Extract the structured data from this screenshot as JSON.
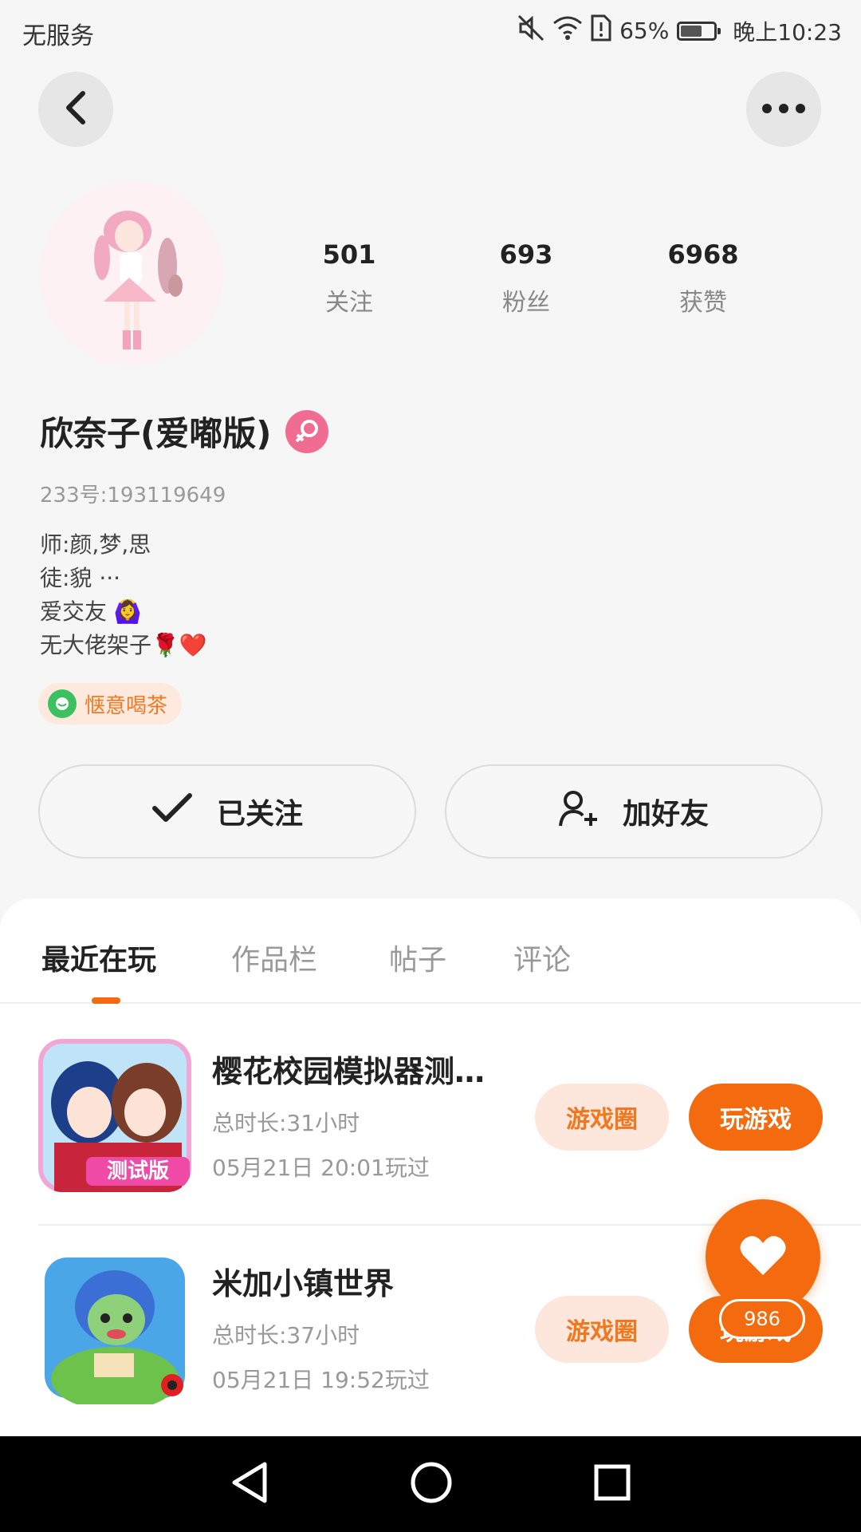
{
  "status_bar": {
    "carrier": "无服务",
    "battery_percent": "65%",
    "battery_level": 0.65,
    "time": "晚上10:23",
    "icons": [
      "mute-icon",
      "wifi-icon",
      "alert-sim-icon",
      "battery-icon"
    ]
  },
  "header": {
    "back_icon": "chevron-left-icon",
    "more_icon": "more-dots-icon"
  },
  "profile": {
    "stats": [
      {
        "value": "501",
        "label": "关注"
      },
      {
        "value": "693",
        "label": "粉丝"
      },
      {
        "value": "6968",
        "label": "获赞"
      }
    ],
    "name": "欣奈子(爱嘟版)",
    "gender_icon": "female-icon",
    "gender_color": "#f16c92",
    "uid": "233号:193119649",
    "bio_lines": [
      "师:颜,梦,思",
      "徒:貌  ···",
      "爱交友 🙆‍♀️",
      "无大佬架子🌹❤️"
    ],
    "tag": "惬意喝茶"
  },
  "actions": {
    "follow_label": "已关注",
    "add_friend_label": "加好友"
  },
  "tabs": [
    "最近在玩",
    "作品栏",
    "帖子",
    "评论"
  ],
  "games": [
    {
      "title": "樱花校园模拟器测…",
      "duration": "总时长:31小时",
      "last_played": "05月21日  20:01玩过",
      "circle_label": "游戏圈",
      "play_label": "玩游戏",
      "icon_badge": "测试版"
    },
    {
      "title": "米加小镇世界",
      "duration": "总时长:37小时",
      "last_played": "05月21日  19:52玩过",
      "circle_label": "游戏圈",
      "play_label": "玩游戏"
    }
  ],
  "fab": {
    "icon": "heart-icon",
    "count": "986"
  },
  "colors": {
    "accent": "#f46b0f",
    "accent_light": "#fde7dc",
    "tag_bg": "#fde9dd"
  },
  "nav": [
    "back-triangle-icon",
    "home-circle-icon",
    "recents-square-icon"
  ]
}
